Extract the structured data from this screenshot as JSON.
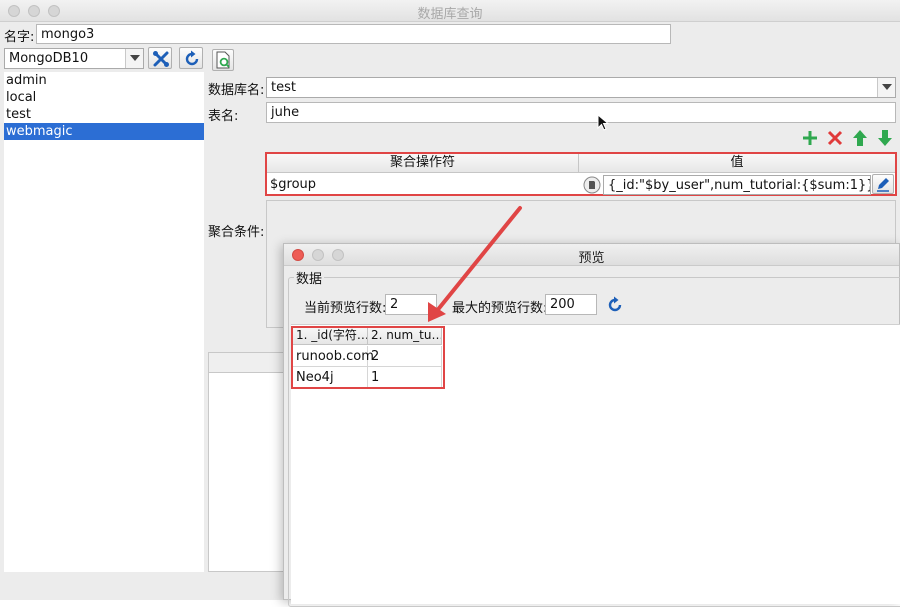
{
  "window": {
    "title": "数据库查询"
  },
  "name_row": {
    "label": "名字:",
    "value": "mongo3"
  },
  "connection": {
    "selected": "MongoDB10"
  },
  "toolbar": {
    "icons": [
      "connect-icon",
      "refresh-icon",
      "export-icon"
    ]
  },
  "databases": [
    "admin",
    "local",
    "test",
    "webmagic"
  ],
  "selected_database_index": 3,
  "form": {
    "db_label": "数据库名:",
    "db_value": "test",
    "table_label": "表名:",
    "table_value": "juhe",
    "agg_label": "聚合条件:"
  },
  "agg_table": {
    "headers": [
      "聚合操作符",
      "值"
    ],
    "row": {
      "operator": "$group",
      "value": "{_id:\"$by_user\",num_tutorial:{$sum:1}}"
    }
  },
  "actions": [
    "add-icon",
    "delete-icon",
    "move-up-icon",
    "move-down-icon"
  ],
  "colors": {
    "add": "#2fa84f",
    "delete": "#e03a3a",
    "arrow": "#2fa84f",
    "annotation": "#e04545",
    "selection": "#2c6ed4"
  },
  "preview": {
    "title": "预览",
    "group_label": "数据",
    "current_label": "当前预览行数:",
    "current_value": "2",
    "max_label": "最大的预览行数:",
    "max_value": "200",
    "columns": [
      "1. _id(字符…",
      "2. num_tu…"
    ],
    "rows": [
      [
        "runoob.com",
        "2"
      ],
      [
        "Neo4j",
        "1"
      ]
    ]
  }
}
